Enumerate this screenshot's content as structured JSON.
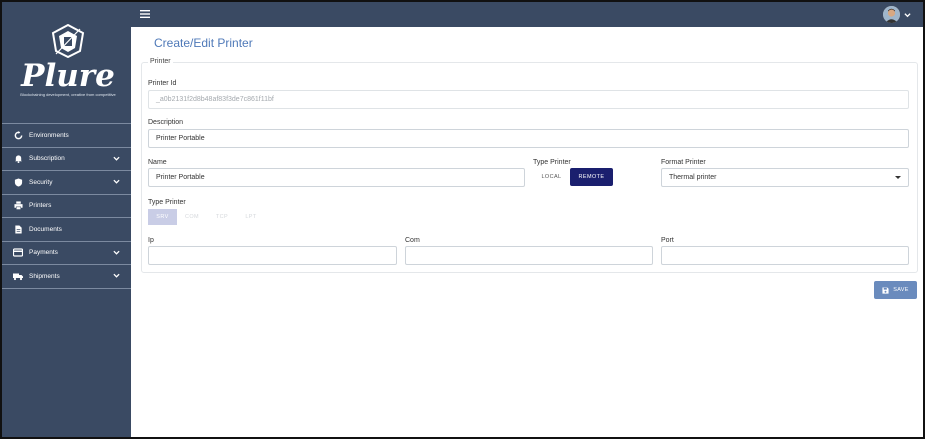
{
  "app": {
    "logo_text": "Plure",
    "logo_tagline": "Blockchaining development, creative from competitive"
  },
  "sidebar": {
    "items": [
      {
        "label": "Environments",
        "icon": "sync-icon",
        "has_submenu": false
      },
      {
        "label": "Subscription",
        "icon": "bell-icon",
        "has_submenu": true
      },
      {
        "label": "Security",
        "icon": "shield-icon",
        "has_submenu": true
      },
      {
        "label": "Printers",
        "icon": "printer-icon",
        "has_submenu": false
      },
      {
        "label": "Documents",
        "icon": "document-icon",
        "has_submenu": false
      },
      {
        "label": "Payments",
        "icon": "credit-card-icon",
        "has_submenu": true
      },
      {
        "label": "Shipments",
        "icon": "truck-icon",
        "has_submenu": true
      }
    ]
  },
  "colors": {
    "sidebar_bg": "#3a4a63",
    "accent_dark": "#1a1f6e",
    "title_blue": "#4f79b8",
    "save_bg": "#6a8bbd"
  },
  "page": {
    "title": "Create/Edit Printer",
    "section_legend": "Printer"
  },
  "form": {
    "printer_id": {
      "label": "Printer Id",
      "value": "_a0b2131f2d8b48af83f3de7c861f11bf"
    },
    "description": {
      "label": "Description",
      "value": "Printer Portable"
    },
    "name": {
      "label": "Name",
      "value": "Printer Portable"
    },
    "type_printer_location": {
      "label": "Type Printer",
      "options": [
        "LOCAL",
        "REMOTE"
      ],
      "selected": "REMOTE"
    },
    "format_printer": {
      "label": "Format Printer",
      "value": "Thermal printer"
    },
    "type_printer_connection": {
      "label": "Type Printer",
      "options": [
        "SRV",
        "COM",
        "TCP",
        "LPT"
      ],
      "selected": "SRV"
    },
    "ip": {
      "label": "Ip",
      "value": ""
    },
    "com": {
      "label": "Com",
      "value": ""
    },
    "port": {
      "label": "Port",
      "value": ""
    }
  },
  "actions": {
    "save_label": "SAVE"
  }
}
